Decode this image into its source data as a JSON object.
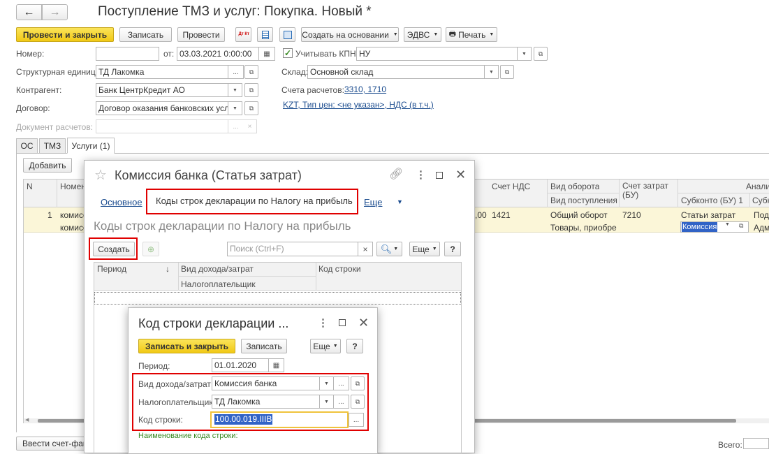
{
  "main": {
    "title": "Поступление ТМЗ и услуг: Покупка. Новый *",
    "toolbar": {
      "post_close": "Провести и закрыть",
      "save": "Записать",
      "post": "Провести",
      "create_based": "Создать на основании",
      "edvs": "ЭДВС",
      "print": "Печать",
      "dt_kt_icon_text": "Дт Кт"
    },
    "fields": {
      "number_label": "Номер:",
      "number_value": "",
      "from_label": "от:",
      "date_value": "03.03.2021  0:00:00",
      "kpn_label": "Учитывать КПН",
      "kpn_value": "НУ",
      "unit_label": "Структурная единица:",
      "unit_value": "ТД Лакомка",
      "warehouse_label": "Склад:",
      "warehouse_value": "Основной склад",
      "contractor_label": "Контрагент:",
      "contractor_value": "Банк ЦентрКредит АО",
      "accounts_label": "Счета расчетов:",
      "accounts_link": "3310, 1710",
      "contract_label": "Договор:",
      "contract_value": "Договор оказания банковских услуг",
      "price_link": "KZT, Тип цен: <не указан>, НДС (в т.ч.)",
      "settlement_doc_label": "Документ расчетов:"
    },
    "tabs": [
      "ОС",
      "ТМЗ",
      "Услуги (1)"
    ],
    "add_button": "Добавить",
    "table": {
      "col_n": "N",
      "col_nom": "Номен",
      "col_vat_account": "Счет НДС",
      "col_turnover_type": "Вид оборота",
      "col_turnover_sub": "Вид поступления",
      "col_cost_account": "Счет затрат (БУ)",
      "col_analytics": "Аналит",
      "col_subconto1": "Субконто (БУ) 1",
      "col_subconto2": "Субко",
      "row": {
        "n": "1",
        "name1": "комисси",
        "name2": "комисс",
        "amount_tail": ",00",
        "vat_account": "1421",
        "turnover": "Общий оборот",
        "receipt": "Товары, приобре",
        "cost_account": "7210",
        "subconto_type": "Статьи затрат",
        "subconto_value": "Комиссия",
        "extra1": "Под",
        "extra2": "Адм"
      }
    },
    "bottom_button": "Ввести счет-факт",
    "bottom_right_label": "Всего:"
  },
  "dialog1": {
    "title": "Комиссия банка (Статья затрат)",
    "tab_main": "Основное",
    "tab_codes": "Коды строк декларации по Налогу на прибыль",
    "tab_more": "Еще",
    "heading": "Коды строк декларации по Налогу на прибыль",
    "create_button": "Создать",
    "search_placeholder": "Поиск (Ctrl+F)",
    "more_button": "Еще",
    "help_button": "?",
    "columns": {
      "period": "Период",
      "sort_arrow": "↓",
      "income_type": "Вид дохода/затрат",
      "taxpayer": "Налогоплательщик",
      "line_code": "Код строки"
    }
  },
  "dialog2": {
    "title": "Код строки декларации ...",
    "save_close": "Записать и закрыть",
    "save": "Записать",
    "more_button": "Еще",
    "help_button": "?",
    "period_label": "Период:",
    "period_value": "01.01.2020",
    "income_label": "Вид дохода/затрат:",
    "income_value": "Комиссия банка",
    "taxpayer_label": "Налогоплательщик:",
    "taxpayer_value": "ТД Лакомка",
    "code_label": "Код строки:",
    "code_value": "100.00.019.IIIВ",
    "code_name_label": "Наименование кода строки:"
  },
  "colors": {
    "accent_yellow": "#f4d12e",
    "highlight_red": "#e00000",
    "link_blue": "#1a4b8e",
    "selection_blue": "#3163c6",
    "row_yellow": "#fbf6d8"
  }
}
